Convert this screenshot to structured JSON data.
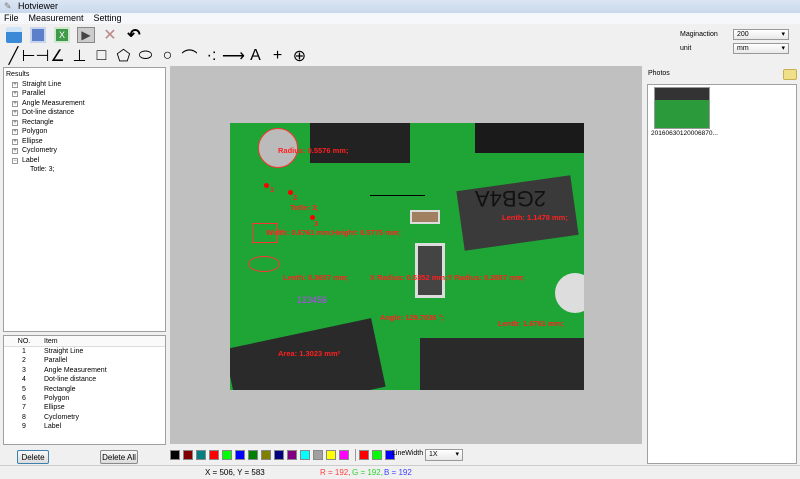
{
  "window": {
    "title": "Hotviewer"
  },
  "menu": [
    "File",
    "Measurement",
    "Setting"
  ],
  "toolbar1": [
    {
      "icon": "save-icon"
    },
    {
      "icon": "word-export-icon"
    },
    {
      "icon": "excel-export-icon"
    },
    {
      "icon": "play-icon"
    },
    {
      "icon": "calibrate-ruler-icon"
    },
    {
      "icon": "undo-icon"
    }
  ],
  "toolbar2": [
    {
      "icon": "straight-line-icon",
      "glyph": "╱"
    },
    {
      "icon": "parallel-icon",
      "glyph": "⊢⊣"
    },
    {
      "icon": "angle-icon",
      "glyph": "∠"
    },
    {
      "icon": "perpendicular-icon",
      "glyph": "⊥"
    },
    {
      "icon": "rectangle-icon",
      "glyph": "□"
    },
    {
      "icon": "polygon-icon",
      "glyph": "⬠"
    },
    {
      "icon": "ellipse-icon",
      "glyph": "⬭"
    },
    {
      "icon": "circle-icon",
      "glyph": "○"
    },
    {
      "icon": "arc-icon",
      "glyph": "⌒"
    },
    {
      "icon": "dot-line-icon",
      "glyph": "·:"
    },
    {
      "icon": "arrow-icon",
      "glyph": "⟶"
    },
    {
      "icon": "text-label-icon",
      "glyph": "A"
    },
    {
      "icon": "crosshair-icon",
      "glyph": "+"
    },
    {
      "icon": "grid-circle-icon",
      "glyph": "⊕"
    }
  ],
  "settings": {
    "magnification_label": "Maginaction",
    "magnification_value": "200",
    "unit_label": "unit",
    "unit_value": "mm"
  },
  "results": {
    "title": "Results",
    "items": [
      "Straight Line",
      "Parallel",
      "Angle Measurement",
      "Dot-line distance",
      "Rectangle",
      "Polygon",
      "Ellipse",
      "Cyclometry",
      "Label"
    ],
    "expanded_child": "Totle: 3;"
  },
  "table": {
    "headers": [
      "NO.",
      "Item"
    ],
    "rows": [
      [
        "1",
        "Straight Line"
      ],
      [
        "2",
        "Parallel"
      ],
      [
        "3",
        "Angle Measurement"
      ],
      [
        "4",
        "Dot-line distance"
      ],
      [
        "5",
        "Rectangle"
      ],
      [
        "6",
        "Polygon"
      ],
      [
        "7",
        "Ellipse"
      ],
      [
        "8",
        "Cyclometry"
      ],
      [
        "9",
        "Label"
      ]
    ]
  },
  "buttons": {
    "delete": "Delete",
    "delete_all": "Delete All"
  },
  "annotations": {
    "radius": "Radius: 0.5576 mm;",
    "label_total": "Totle: 3;",
    "points": [
      "1",
      "2",
      "3"
    ],
    "rect": "Width: 0.6761 mm;Height: 0.5775 mm;",
    "lenth1": "Lenth: 1.1478 mm;",
    "ellipse": "X Radius: 0.5352 mm;Y Radius: 0.2887 mm;",
    "angle": "Angle: 129.7036 °;",
    "lenth2": "Lenth: 1.6761 mm;",
    "lenth3": "Lenth: 0.3657 mm;",
    "text": "123456",
    "area": "Area: 1.3023 mm²"
  },
  "palette": {
    "colors": [
      "#000000",
      "#800000",
      "#008080",
      "#ff0000",
      "#00ff00",
      "#0000ff",
      "#008000",
      "#808000",
      "#000080",
      "#800080",
      "#00ffff",
      "#a0a0a0",
      "#ffff00",
      "#ff00ff"
    ],
    "current": [
      "#ff0000",
      "#00ff00",
      "#0000ff"
    ]
  },
  "linewidth": {
    "label": "LineWidth",
    "value": "1X"
  },
  "status": {
    "coords": "X = 506, Y = 583",
    "r": "R = 192,",
    "g": "G = 192,",
    "b": "B = 192"
  },
  "photos": {
    "title": "Photos",
    "items": [
      {
        "name": "20160630120006870..."
      }
    ]
  }
}
